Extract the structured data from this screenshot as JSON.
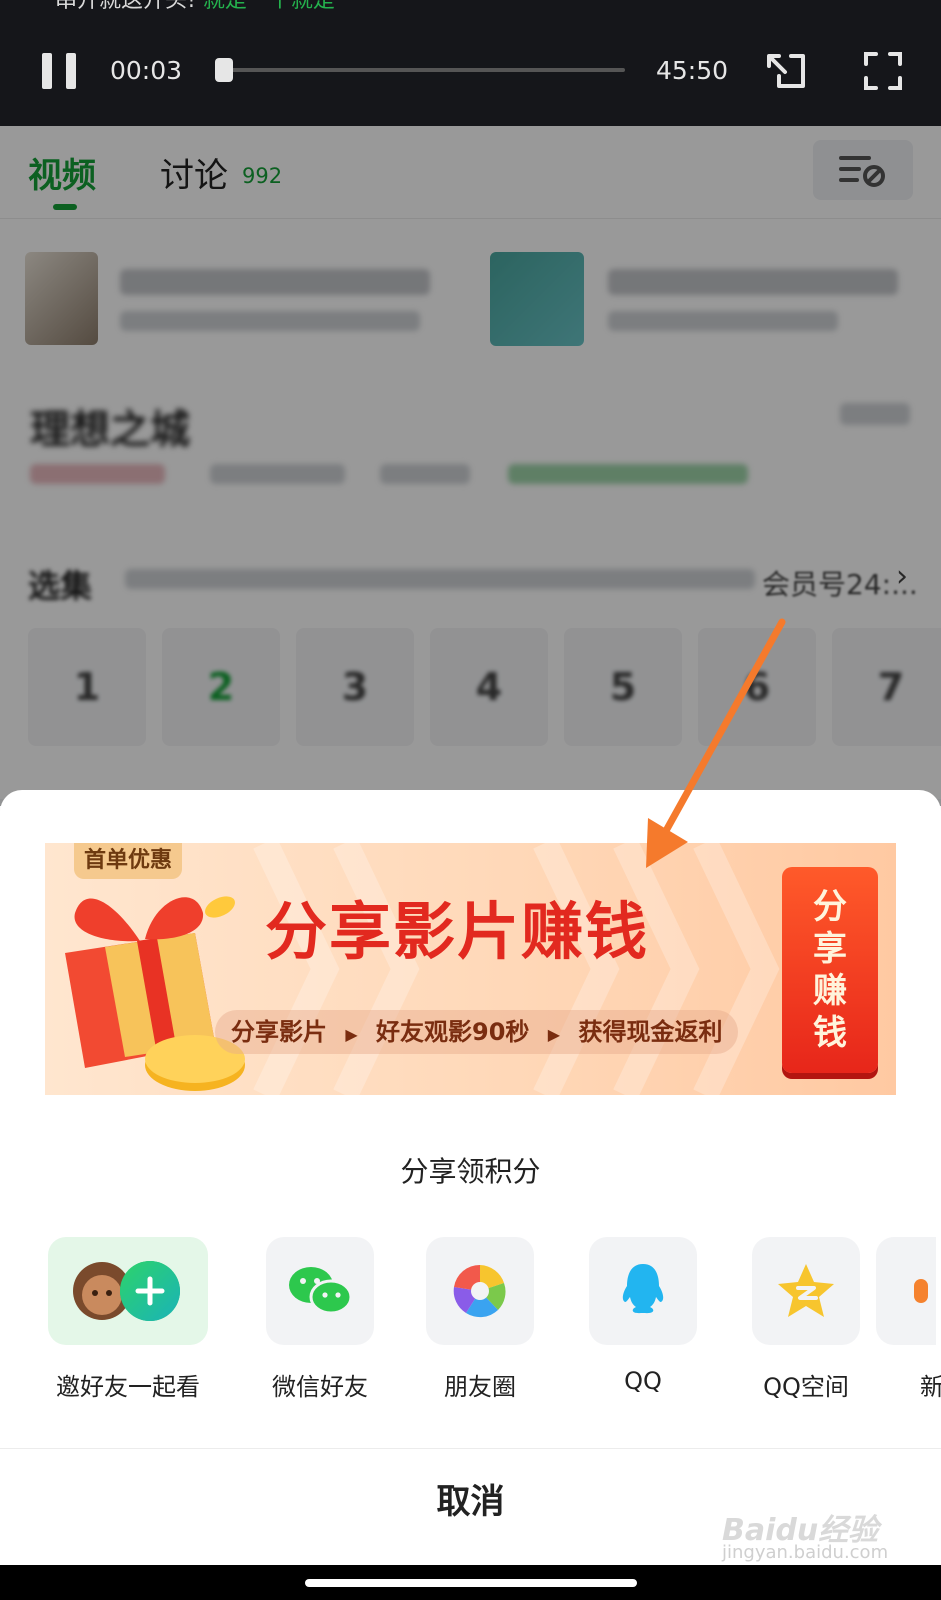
{
  "player": {
    "cut_text": "串开就这开头!",
    "cut_green": "就是一个就是",
    "current_time": "00:03",
    "total_time": "45:50",
    "progress_fraction": 0.001
  },
  "tabs": {
    "video": "视频",
    "discuss": "讨论",
    "discuss_count": "992"
  },
  "content": {
    "show_title": "理想之城",
    "episodes_label": "选集",
    "episodes_more": "会员号24:...",
    "episodes": [
      "1",
      "2",
      "3",
      "4",
      "5",
      "6",
      "7"
    ]
  },
  "banner": {
    "badge": "首单优惠",
    "title": "分享影片赚钱",
    "steps": [
      "分享影片",
      "好友观影90秒",
      "获得现金返利"
    ],
    "cta": [
      "分",
      "享",
      "赚",
      "钱"
    ]
  },
  "sheet": {
    "title": "分享领积分",
    "items": [
      {
        "label": "邀好友一起看",
        "icon": "invite-friends-icon"
      },
      {
        "label": "微信好友",
        "icon": "wechat-icon"
      },
      {
        "label": "朋友圈",
        "icon": "moments-icon"
      },
      {
        "label": "QQ",
        "icon": "qq-icon"
      },
      {
        "label": "QQ空间",
        "icon": "qzone-icon"
      },
      {
        "label": "新",
        "icon": "weibo-icon"
      }
    ],
    "cancel": "取消"
  },
  "watermark": {
    "brand": "Baidu经验",
    "url": "jingyan.baidu.com"
  },
  "colors": {
    "accent_green": "#14a037",
    "banner_red": "#e2291f",
    "annotation_orange": "#f57a2c"
  }
}
